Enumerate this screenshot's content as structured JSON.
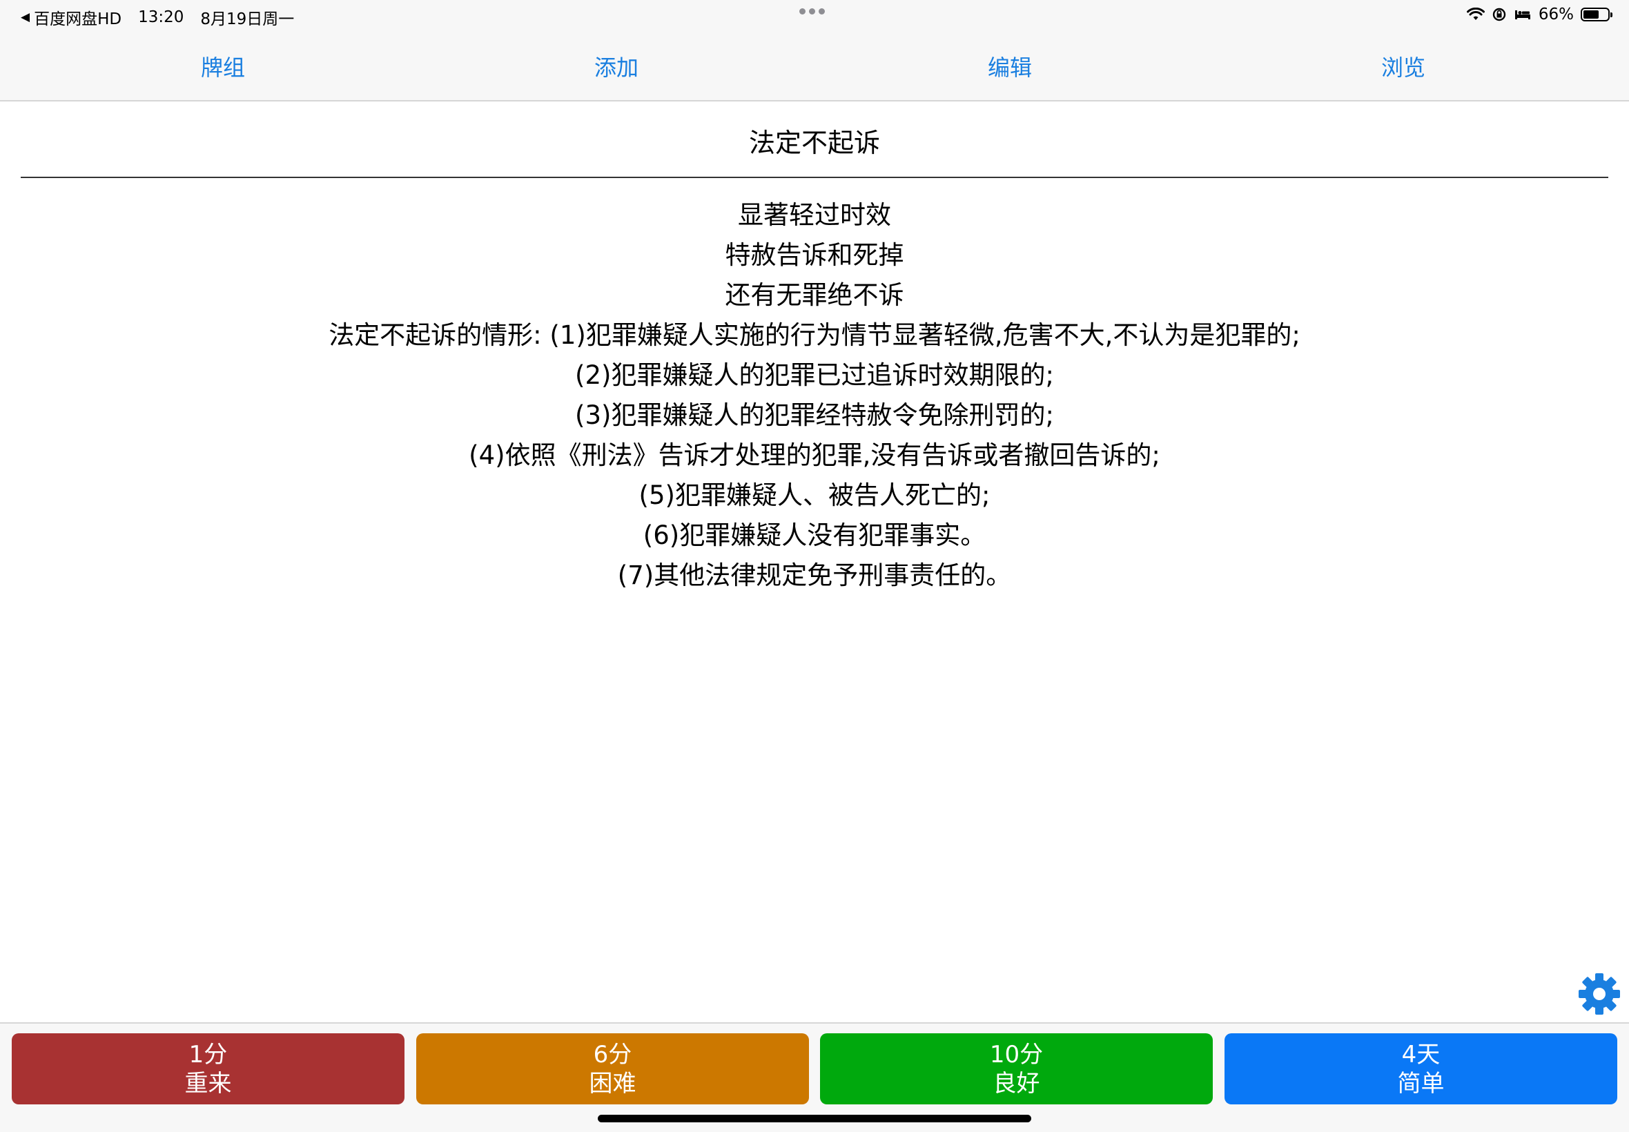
{
  "status_bar": {
    "back_app": "百度网盘HD",
    "time": "13:20",
    "date": "8月19日周一",
    "battery": "66%",
    "battery_level": 0.66
  },
  "nav": {
    "tabs": [
      {
        "label": "牌组"
      },
      {
        "label": "添加"
      },
      {
        "label": "编辑"
      },
      {
        "label": "浏览"
      }
    ],
    "accent_color": "#1a7fe0"
  },
  "card": {
    "question": "法定不起诉",
    "answer_lines": [
      "显著轻过时效",
      "特赦告诉和死掉",
      "还有无罪绝不诉",
      "法定不起诉的情形: (1)犯罪嫌疑人实施的行为情节显著轻微,危害不大,不认为是犯罪的;",
      "(2)犯罪嫌疑人的犯罪已过追诉时效期限的;",
      "(3)犯罪嫌疑人的犯罪经特赦令免除刑罚的;",
      "(4)依照《刑法》告诉才处理的犯罪,没有告诉或者撤回告诉的;",
      "(5)犯罪嫌疑人、被告人死亡的;",
      "(6)犯罪嫌疑人没有犯罪事实。",
      "(7)其他法律规定免予刑事责任的。"
    ]
  },
  "settings_icon": "gear-icon",
  "answer_buttons": [
    {
      "interval": "1分",
      "label": "重来",
      "color": "#a83232"
    },
    {
      "interval": "6分",
      "label": "困难",
      "color": "#cc7800"
    },
    {
      "interval": "10分",
      "label": "良好",
      "color": "#00a90d"
    },
    {
      "interval": "4天",
      "label": "简单",
      "color": "#0a78f6"
    }
  ]
}
